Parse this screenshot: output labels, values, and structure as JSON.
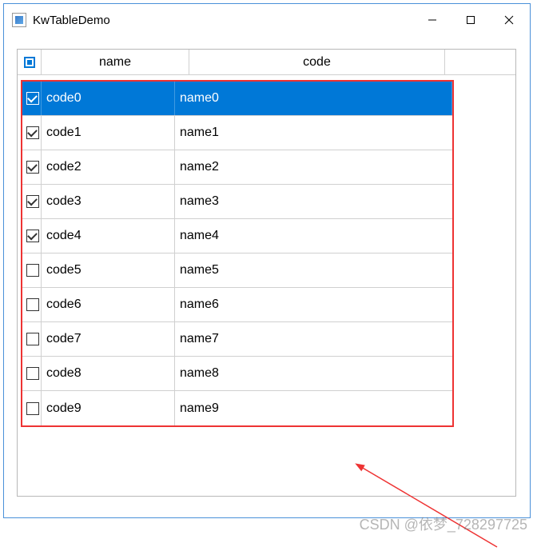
{
  "window": {
    "title": "KwTableDemo"
  },
  "table": {
    "headers": {
      "name": "name",
      "code": "code"
    },
    "rows": [
      {
        "checked": true,
        "name": "code0",
        "code": "name0",
        "selected": true
      },
      {
        "checked": true,
        "name": "code1",
        "code": "name1",
        "selected": false
      },
      {
        "checked": true,
        "name": "code2",
        "code": "name2",
        "selected": false
      },
      {
        "checked": true,
        "name": "code3",
        "code": "name3",
        "selected": false
      },
      {
        "checked": true,
        "name": "code4",
        "code": "name4",
        "selected": false
      },
      {
        "checked": false,
        "name": "code5",
        "code": "name5",
        "selected": false
      },
      {
        "checked": false,
        "name": "code6",
        "code": "name6",
        "selected": false
      },
      {
        "checked": false,
        "name": "code7",
        "code": "name7",
        "selected": false
      },
      {
        "checked": false,
        "name": "code8",
        "code": "name8",
        "selected": false
      },
      {
        "checked": false,
        "name": "code9",
        "code": "name9",
        "selected": false
      }
    ]
  },
  "annotation": {
    "highlight_color": "#e33"
  },
  "watermark": "CSDN @依梦_728297725"
}
